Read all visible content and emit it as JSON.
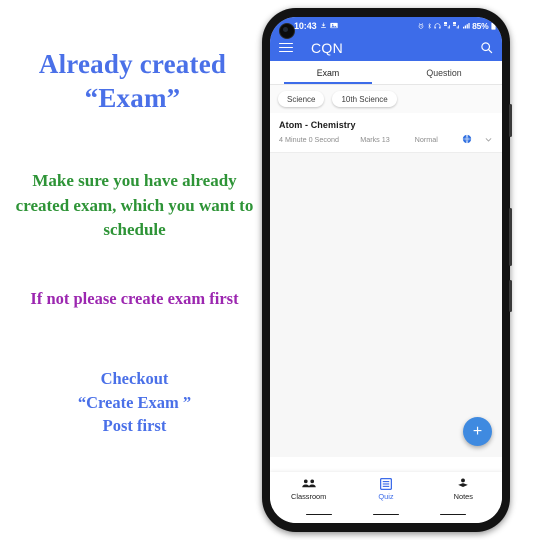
{
  "annotations": {
    "title": "Already created\n“Exam”",
    "green_note": "Make sure you have already created exam, which you want to schedule",
    "purple_note": "If not please create exam first",
    "blue_note": "Checkout\n“Create Exam ”\nPost first",
    "colors": {
      "title": "#4a70e8",
      "green": "#2e9437",
      "purple": "#9c27b0",
      "blue": "#4a70e8"
    }
  },
  "phone": {
    "statusbar": {
      "time": "10:43",
      "battery": "85%",
      "icons_left": [
        "downloads-icon",
        "screenshot-icon"
      ],
      "icons_right": [
        "alarm-icon",
        "bluetooth-icon",
        "headset-icon",
        "sim1-signal-icon",
        "sim2-signal-icon",
        "wifi-signal-icon",
        "battery-icon"
      ]
    },
    "appbar": {
      "menu_icon": "hamburger-menu-icon",
      "title": "CQN",
      "search_icon": "search-icon",
      "background": "#3d6ce9"
    },
    "tabs": [
      {
        "label": "Exam",
        "active": true
      },
      {
        "label": "Question",
        "active": false
      }
    ],
    "chips": [
      {
        "label": "Science"
      },
      {
        "label": "10th Science"
      }
    ],
    "exam_card": {
      "title": "Atom - Chemistry",
      "duration": "4 Minute 0 Second",
      "marks": "Marks 13",
      "level": "Normal",
      "visibility_icon": "globe-public-icon",
      "expand_icon": "chevron-down-icon"
    },
    "fab": {
      "label": "+",
      "icon": "plus-icon",
      "color": "#3f8ae0"
    },
    "bottom_nav": [
      {
        "label": "Classroom",
        "icon": "people-group-icon",
        "active": false
      },
      {
        "label": "Quiz",
        "icon": "list-quiz-icon",
        "active": true
      },
      {
        "label": "Notes",
        "icon": "book-notes-icon",
        "active": false
      }
    ]
  }
}
